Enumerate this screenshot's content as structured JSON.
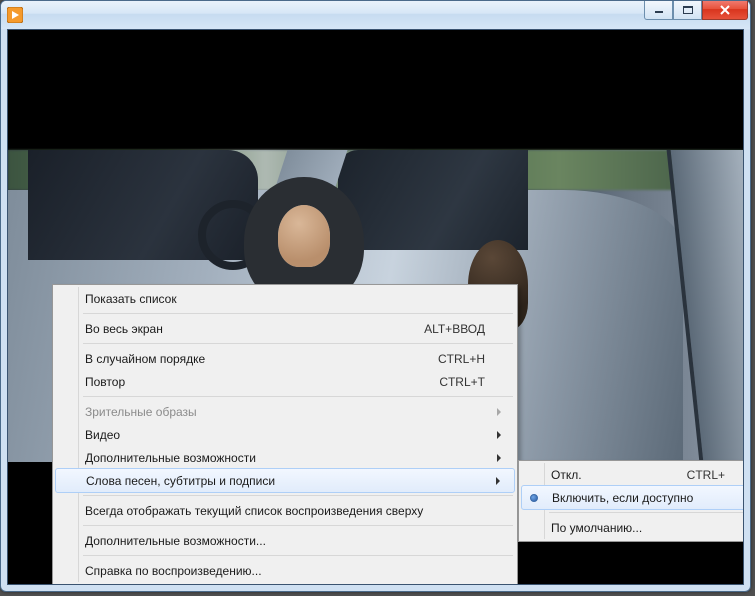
{
  "menu": {
    "show_list": "Показать список",
    "fullscreen": "Во весь экран",
    "fullscreen_shortcut": "ALT+ВВОД",
    "shuffle": "В случайном порядке",
    "shuffle_shortcut": "CTRL+H",
    "repeat": "Повтор",
    "repeat_shortcut": "CTRL+T",
    "visualizations": "Зрительные образы",
    "video": "Видео",
    "enhancements": "Дополнительные возможности",
    "lyrics": "Слова песен, субтитры и подписи",
    "always_on_top": "Всегда отображать текущий список воспроизведения сверху",
    "more_options": "Дополнительные возможности...",
    "playback_help": "Справка по воспроизведению..."
  },
  "submenu": {
    "off": "Откл.",
    "off_shortcut": "CTRL+",
    "on_if_available": "Включить, если доступно",
    "defaults": "По умолчанию..."
  }
}
